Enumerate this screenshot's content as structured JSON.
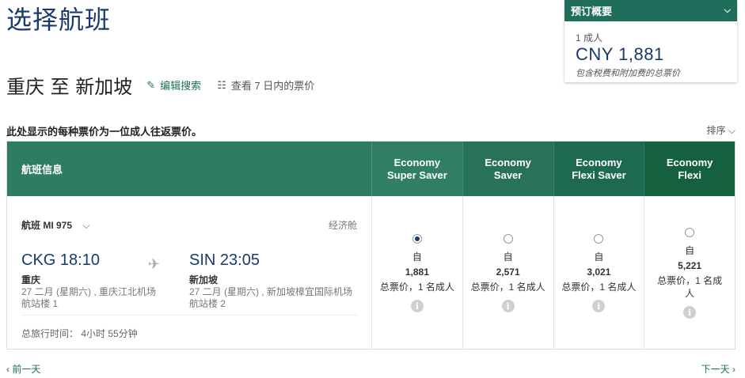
{
  "page": {
    "title": "选择航班"
  },
  "summary": {
    "header": "预订概要",
    "pax": "1 成人",
    "price": "CNY 1,881",
    "note": "包含税费和附加费的总票价"
  },
  "route": {
    "title": "重庆 至 新加坡",
    "edit_label": "编辑搜索",
    "view7_label": "查看 7 日内的票价"
  },
  "note": "此处显示的每种票价为一位成人往返票价。",
  "sort_label": "排序",
  "table": {
    "info_header": "航班信息",
    "fare_headers": [
      {
        "label": "Economy\nSuper Saver",
        "color": "#2f7e65"
      },
      {
        "label": "Economy\nSaver",
        "color": "#277258"
      },
      {
        "label": "Economy\nFlexi Saver",
        "color": "#1e6a50"
      },
      {
        "label": "Economy\nFlexi",
        "color": "#15603f"
      }
    ],
    "flight": {
      "number": "航班 MI 975",
      "cabin": "经济舱",
      "departure": {
        "time": "CKG 18:10",
        "city": "重庆",
        "date_airport": "27 二月 (星期六) , 重庆江北机场",
        "terminal": "航站楼 1"
      },
      "arrival": {
        "time": "SIN 23:05",
        "city": "新加坡",
        "date_airport": "27 二月 (星期六) , 新加坡樟宜国际机场",
        "terminal": "航站楼 2"
      },
      "total_time": "总旅行时间： 4小时 55分钟"
    },
    "fares": [
      {
        "from": "自",
        "price": "1,881",
        "sub": "总票价，1 名成人",
        "selected": true
      },
      {
        "from": "自",
        "price": "2,571",
        "sub": "总票价，1 名成人",
        "selected": false
      },
      {
        "from": "自",
        "price": "3,021",
        "sub": "总票价，1 名成人",
        "selected": false
      },
      {
        "from": "自",
        "price": "5,221",
        "sub": "总票价，1 名成人",
        "selected": false
      }
    ],
    "info_glyph": "i"
  },
  "nav": {
    "prev": "‹ 前一天",
    "next": "下一天 ›"
  },
  "colors": {
    "brand_green": "#1f6e5b",
    "navy": "#1a3a6b"
  }
}
